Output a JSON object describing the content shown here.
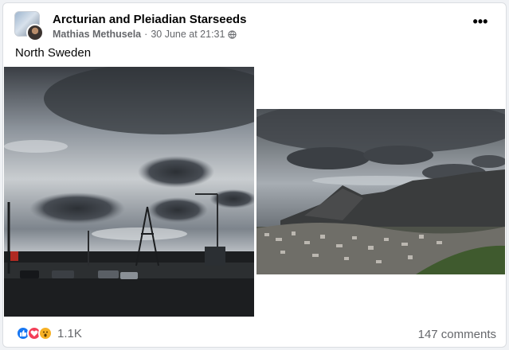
{
  "post": {
    "group_name": "Arcturian and Pleiadian Starseeds",
    "author": "Mathias Methusela",
    "separator": "·",
    "timestamp": "30 June at 21:31",
    "privacy_icon": "globe-icon",
    "more_label": "•••",
    "text": "North Sweden"
  },
  "media": {
    "left_photo": "stormy sky with lenticular saucer-shaped clouds over a road and streetlights",
    "right_photo": "lenticular clouds above a mountain range and a city"
  },
  "footer": {
    "reaction_icons": [
      "like-icon",
      "love-icon",
      "wow-icon"
    ],
    "reaction_count": "1.1K",
    "comments": "147 comments"
  },
  "colors": {
    "secondary_text": "#65676b",
    "like": "#1877f2",
    "love": "#f33e58",
    "wow": "#f7b125"
  }
}
